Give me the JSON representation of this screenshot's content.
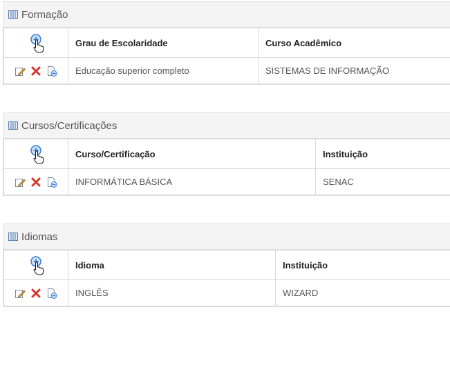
{
  "sections": [
    {
      "title": "Formação",
      "columns": [
        "Grau de Escolaridade",
        "Curso Acadêmico"
      ],
      "rows": [
        [
          "Educação superior completo",
          "SISTEMAS DE INFORMAÇÃO"
        ]
      ]
    },
    {
      "title": "Cursos/Certificações",
      "columns": [
        "Curso/Certificação",
        "Instituição"
      ],
      "rows": [
        [
          "INFORMÁTICA BÁSICA",
          "SENAC"
        ]
      ]
    },
    {
      "title": "Idiomas",
      "columns": [
        "Idioma",
        "Instituição"
      ],
      "rows": [
        [
          "INGLÊS",
          "WIZARD"
        ]
      ]
    }
  ],
  "icons": {
    "panel": "grid-icon",
    "add": "add-icon",
    "cursor": "hand-pointer-icon",
    "edit": "edit-icon",
    "delete": "delete-icon",
    "remove": "remove-icon"
  },
  "colors": {
    "header_bg": "#f4f4f4",
    "border": "#d8d8d8",
    "add_blue": "#3a7bd5",
    "delete_red": "#d9342b"
  }
}
